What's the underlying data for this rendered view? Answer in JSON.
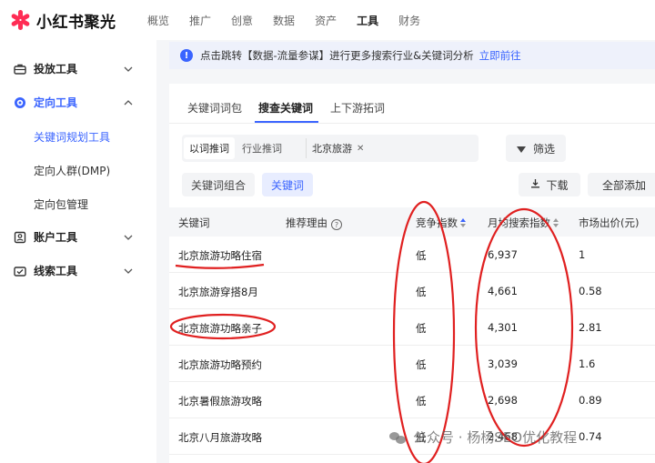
{
  "brand": {
    "name": "小红书聚光",
    "accent": "#3a64ff",
    "logo_color": "#ff2d55"
  },
  "topnav": {
    "items": [
      {
        "label": "概览",
        "active": false
      },
      {
        "label": "推广",
        "active": false
      },
      {
        "label": "创意",
        "active": false
      },
      {
        "label": "数据",
        "active": false
      },
      {
        "label": "资产",
        "active": false
      },
      {
        "label": "工具",
        "active": true
      },
      {
        "label": "财务",
        "active": false
      }
    ]
  },
  "sidebar": {
    "groups": [
      {
        "label": "投放工具",
        "icon": "toolbox-icon",
        "expanded": false
      },
      {
        "label": "定向工具",
        "icon": "target-icon",
        "expanded": true
      },
      {
        "label": "账户工具",
        "icon": "account-icon",
        "expanded": false
      },
      {
        "label": "线索工具",
        "icon": "leads-icon",
        "expanded": false
      }
    ],
    "sub_items": [
      {
        "label": "关键词规划工具",
        "active": true
      },
      {
        "label": "定向人群(DMP)",
        "active": false
      },
      {
        "label": "定向包管理",
        "active": false
      }
    ]
  },
  "banner": {
    "text": "点击跳转【数据-流量参谋】进行更多搜索行业&关键词分析",
    "link": "立即前往",
    "icon": "info-icon"
  },
  "tabs": [
    {
      "label": "关键词词包",
      "active": false
    },
    {
      "label": "搜查关键词",
      "active": true
    },
    {
      "label": "上下游拓词",
      "active": false
    }
  ],
  "filters": {
    "mode_options": [
      "以词推词",
      "行业推词"
    ],
    "mode_selected": "以词推词",
    "chip": "北京旅游",
    "filter_button": "筛选"
  },
  "toolbar": {
    "view_options": [
      "关键词组合",
      "关键词"
    ],
    "view_selected": "关键词",
    "download": "下载",
    "add_all": "全部添加"
  },
  "table": {
    "columns": [
      "关键词",
      "推荐理由",
      "竞争指数",
      "月均搜索指数",
      "市场出价(元)"
    ],
    "rows": [
      {
        "keyword": "北京旅游功略住宿",
        "competition": "低",
        "monthly_search": "6,937",
        "price": "1"
      },
      {
        "keyword": "北京旅游穿搭8月",
        "competition": "低",
        "monthly_search": "4,661",
        "price": "0.58"
      },
      {
        "keyword": "北京旅游功略亲子",
        "competition": "低",
        "monthly_search": "4,301",
        "price": "2.81"
      },
      {
        "keyword": "北京旅游功略预约",
        "competition": "低",
        "monthly_search": "3,039",
        "price": "1.6"
      },
      {
        "keyword": "北京暑假旅游攻略",
        "competition": "低",
        "monthly_search": "2,698",
        "price": "0.89"
      },
      {
        "keyword": "北京八月旅游攻略",
        "competition": "低",
        "monthly_search": "2,468",
        "price": "0.74"
      }
    ]
  },
  "annotation_color": "#e02020",
  "watermark": "公众号 · 杨杨SEO优化教程"
}
